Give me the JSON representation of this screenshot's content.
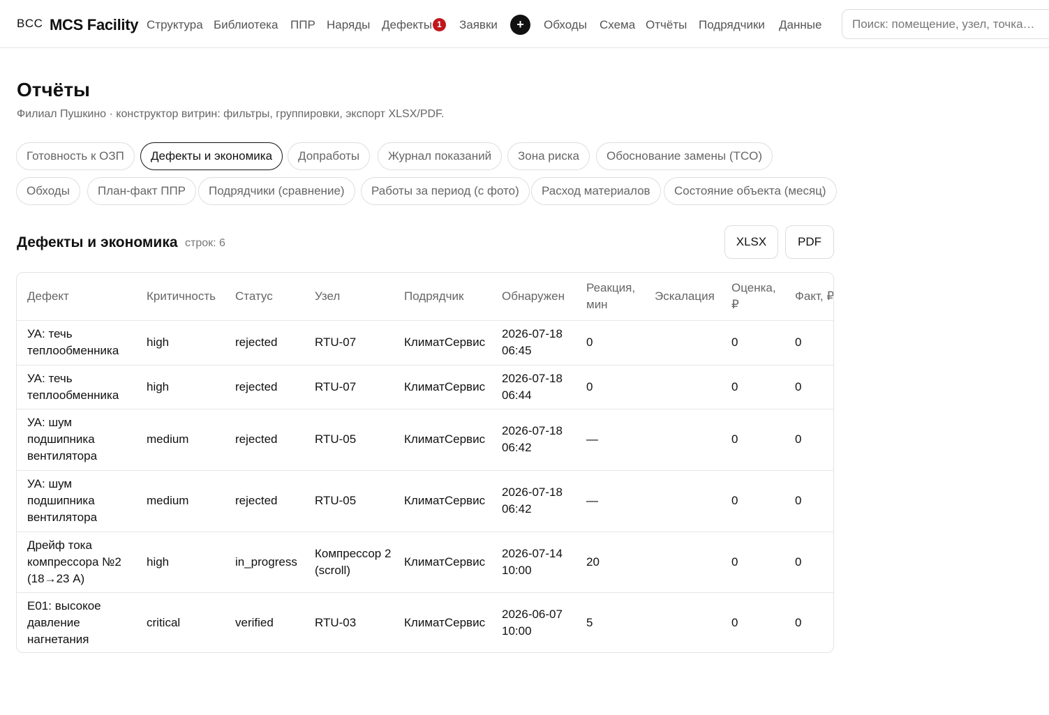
{
  "brand": {
    "short": "BCC",
    "name": "MCS Facility"
  },
  "nav": {
    "items": [
      "Структура",
      "Библиотека",
      "ППР",
      "Наряды",
      "Дефекты",
      "Заявки",
      "Обходы",
      "Схема",
      "Отчёты",
      "Подрядчики",
      "Данные"
    ],
    "defects_badge": "1",
    "plus_label": "+"
  },
  "search": {
    "placeholder": "Поиск: помещение, узел, точка…",
    "value": ""
  },
  "page": {
    "title": "Отчёты",
    "subtitle": "Филиал Пушкино · конструктор витрин: фильтры, группировки, экспорт XLSX/PDF."
  },
  "reports": {
    "active": "Дефекты и экономика",
    "items": [
      "Готовность к ОЗП",
      "Дефекты и экономика",
      "Допработы",
      "Журнал показаний",
      "Зона риска",
      "Обоснование замены (TCO)",
      "Обходы",
      "План-факт ППР",
      "Подрядчики (сравнение)",
      "Работы за период (с фото)",
      "Расход материалов",
      "Состояние объекта (месяц)"
    ]
  },
  "section": {
    "title": "Дефекты и экономика",
    "row_count": "строк: 6",
    "export_xlsx": "XLSX",
    "export_pdf": "PDF"
  },
  "table": {
    "columns": [
      "Дефект",
      "Критичность",
      "Статус",
      "Узел",
      "Подрядчик",
      "Обнаружен",
      "Реакция, мин",
      "Эскалация",
      "Оценка, ₽",
      "Факт, ₽"
    ],
    "rows": [
      [
        "УА: течь теплообменника",
        "high",
        "rejected",
        "RTU-07",
        "КлиматСервис",
        "2026-07-18 06:45",
        "0",
        "",
        "0",
        "0"
      ],
      [
        "УА: течь теплообменника",
        "high",
        "rejected",
        "RTU-07",
        "КлиматСервис",
        "2026-07-18 06:44",
        "0",
        "",
        "0",
        "0"
      ],
      [
        "УА: шум подшипника вентилятора",
        "medium",
        "rejected",
        "RTU-05",
        "КлиматСервис",
        "2026-07-18 06:42",
        "—",
        "",
        "0",
        "0"
      ],
      [
        "УА: шум подшипника вентилятора",
        "medium",
        "rejected",
        "RTU-05",
        "КлиматСервис",
        "2026-07-18 06:42",
        "—",
        "",
        "0",
        "0"
      ],
      [
        "Дрейф тока компрессора №2 (18→23 А)",
        "high",
        "in_progress",
        "Компрессор 2 (scroll)",
        "КлиматСервис",
        "2026-07-14 10:00",
        "20",
        "",
        "0",
        "0"
      ],
      [
        "E01: высокое давление нагнетания",
        "critical",
        "verified",
        "RTU-03",
        "КлиматСервис",
        "2026-06-07 10:00",
        "5",
        "",
        "0",
        "0"
      ]
    ]
  },
  "colors": {
    "badge": "#c0161c",
    "text": "#111111",
    "muted": "#666666",
    "border": "#e3e3e3"
  }
}
